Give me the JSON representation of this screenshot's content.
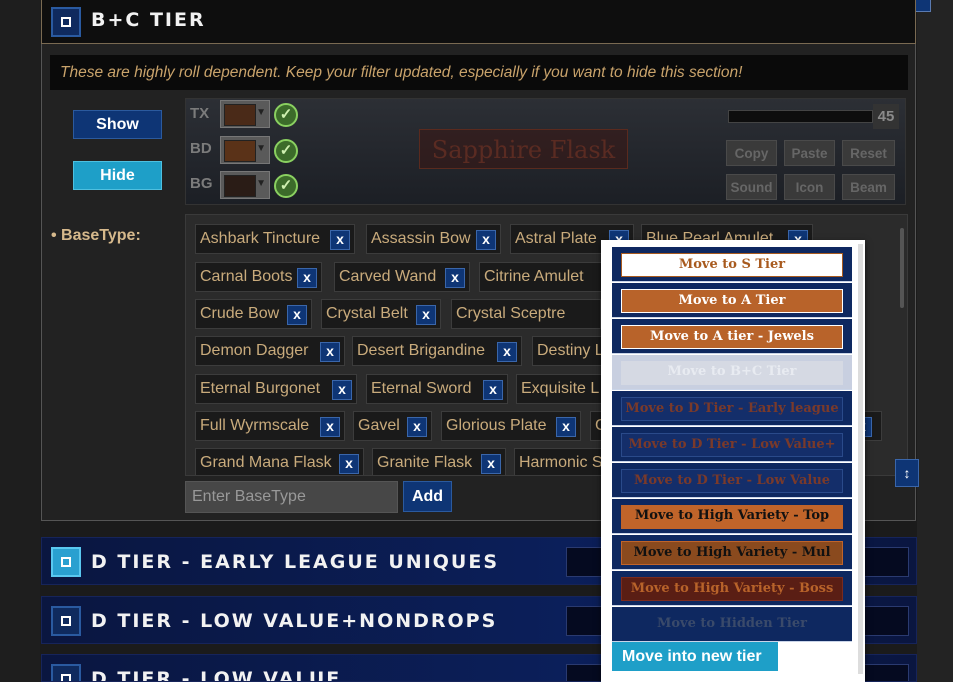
{
  "colors": {
    "accent_blue": "#0e3575",
    "accent_cyan": "#1e9fc8",
    "tag_text": "#c9ab7c",
    "note_text": "#c9a36b",
    "tier_bar": "#0b1f5a",
    "text_color_swatch": "#4a2a18",
    "border_color_swatch": "#5a3218",
    "background_color_swatch": "#2a1c16"
  },
  "bc_tier": {
    "title": "B+C TIER",
    "note": "These are highly roll dependent. Keep your filter updated, especially if you want to hide this section!",
    "show_label": "Show",
    "hide_label": "Hide",
    "preview": {
      "labels": [
        "TX",
        "BD",
        "BG"
      ],
      "item_name": "Sapphire Flask",
      "size_value": "45",
      "buttons_row1": [
        "Copy",
        "Paste",
        "Reset"
      ],
      "buttons_row2": [
        "Sound",
        "Icon",
        "Beam"
      ]
    },
    "base_type_label": "• BaseType:",
    "tags": [
      "Ashbark Tincture",
      "Assassin Bow",
      "Astral Plate",
      "Blue Pearl Amulet",
      "Carnal Boots",
      "Carved Wand",
      "Citrine Amulet",
      "Crude Bow",
      "Crystal Belt",
      "Crystal Sceptre",
      "Demon Dagger",
      "Desert Brigandine",
      "Destiny L",
      "Eternal Burgonet",
      "Eternal Sword",
      "Exquisite L",
      "Full Wyrmscale",
      "Gavel",
      "Glorious Plate",
      "G",
      "Grand Mana Flask",
      "Granite Flask",
      "Harmonic S"
    ],
    "remove_label": "x",
    "input_placeholder": "Enter BaseType",
    "add_label": "Add"
  },
  "lower_tiers": [
    {
      "title": "D TIER - EARLY LEAGUE UNIQUES",
      "checked": true
    },
    {
      "title": "D TIER - LOW VALUE+NONDROPS",
      "checked": false
    },
    {
      "title": "D TIER - LOW VALUE",
      "checked": false
    }
  ],
  "menu": {
    "items": [
      {
        "label": "Move to S Tier",
        "style": "white"
      },
      {
        "label": "Move to A Tier",
        "style": "orange"
      },
      {
        "label": "Move to A tier - Jewels",
        "style": "orange"
      },
      {
        "label": "Move to B+C Tier",
        "style": "disabled"
      },
      {
        "label": "Move to D Tier - Early league",
        "style": "dim"
      },
      {
        "label": "Move to D Tier - Low Value+",
        "style": "dim"
      },
      {
        "label": "Move to D Tier - Low Value",
        "style": "dim"
      },
      {
        "label": "Move to High Variety - Top",
        "style": "orange-flat"
      },
      {
        "label": "Move to High Variety - Mul",
        "style": "orange-dark"
      },
      {
        "label": "Move to High Variety - Boss",
        "style": "red-dark"
      },
      {
        "label": "Move to Hidden Tier",
        "style": "hidden"
      }
    ],
    "new_tier_label": "Move into new tier"
  }
}
